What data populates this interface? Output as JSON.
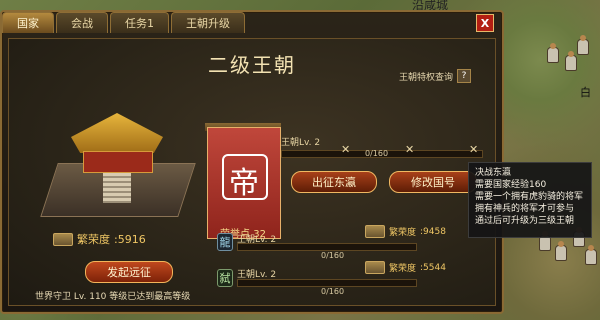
{
  "map": {
    "label_top": "沿咸城",
    "label_right": "白"
  },
  "tabs": [
    {
      "label": "国家",
      "active": true
    },
    {
      "label": "会战",
      "active": false
    },
    {
      "label": "任务1",
      "active": false
    },
    {
      "label": "王朝升级",
      "active": false
    }
  ],
  "close_label": "X",
  "title": "二级王朝",
  "query": {
    "label": "王朝特权查询",
    "help": "?"
  },
  "left": {
    "prosperity_label": "繁荣度",
    "prosperity_value": ":5916",
    "launch_button": "发起远征",
    "guard_text": "世界守卫  Lv. 110  等级已达到最高等级"
  },
  "banner": {
    "glyph": "帝",
    "points_label": "荣誉点 32"
  },
  "main_progress": {
    "level": "王朝Lv. 2",
    "value": "0/160",
    "fraction": 0.0
  },
  "buttons": {
    "expedition": "出征东瀛",
    "rename": "修改国号"
  },
  "rows": [
    {
      "icon": "龍",
      "level": "王朝Lv. 2",
      "progress": "0/160",
      "fraction": 0.0,
      "prosperity_label": "繁荣度",
      "prosperity_value": ":9458"
    },
    {
      "icon": "弑",
      "level": "王朝Lv. 2",
      "progress": "0/160",
      "fraction": 0.0,
      "prosperity_label": "繁荣度",
      "prosperity_value": ":5544"
    }
  ],
  "tooltip": {
    "lines": [
      "决战东瀛",
      "需要国家经验160",
      "需要一个拥有虎豹骑的将军",
      "拥有神兵的将军才可参与",
      "通过后可升级为三级王朝"
    ]
  },
  "colors": {
    "accent_gold": "#e5b74b",
    "panel_border": "#8a6a34",
    "close_red": "#b31e12",
    "banner_red": "#c0473b"
  }
}
